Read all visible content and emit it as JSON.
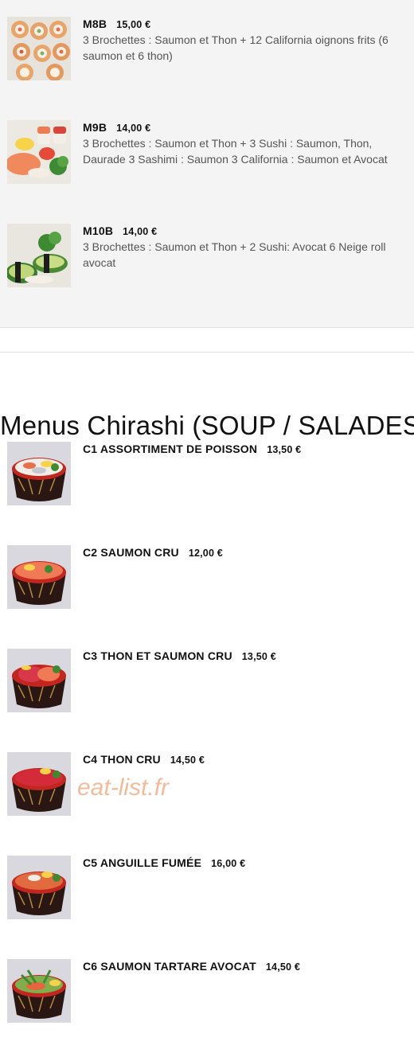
{
  "menu_items_top": [
    {
      "code": "M8B",
      "price": "15,00 €",
      "description": "3 Brochettes : Saumon et Thon + 12 California oignons frits (6 saumon et 6 thon)"
    },
    {
      "code": "M9B",
      "price": "14,00 €",
      "description": "3 Brochettes : Saumon et Thon + 3 Sushi : Saumon, Thon, Daurade 3 Sashimi : Saumon 3 California : Saumon et Avocat"
    },
    {
      "code": "M10B",
      "price": "14,00 €",
      "description": "3 Brochettes : Saumon et Thon + 2 Sushi: Avocat 6 Neige roll avocat"
    }
  ],
  "section": {
    "title": "Menus Chirashi (SOUP / SALADES)"
  },
  "chirashi_items": [
    {
      "name": "C1 ASSORTIMENT DE POISSON",
      "price": "13,50 €"
    },
    {
      "name": "C2 SAUMON CRU",
      "price": "12,00 €"
    },
    {
      "name": "C3 THON ET SAUMON CRU",
      "price": "13,50 €"
    },
    {
      "name": "C4 THON CRU",
      "price": "14,50 €"
    },
    {
      "name": "C5 ANGUILLE FUMÉE",
      "price": "16,00 €"
    },
    {
      "name": "C6 SAUMON TARTARE AVOCAT",
      "price": "14,50 €"
    }
  ],
  "watermark": "eat-list.fr",
  "colors": {
    "gray_bg": "#f4f4f4",
    "text": "#111111",
    "desc_text": "#555555",
    "watermark": "#f3b48e"
  }
}
